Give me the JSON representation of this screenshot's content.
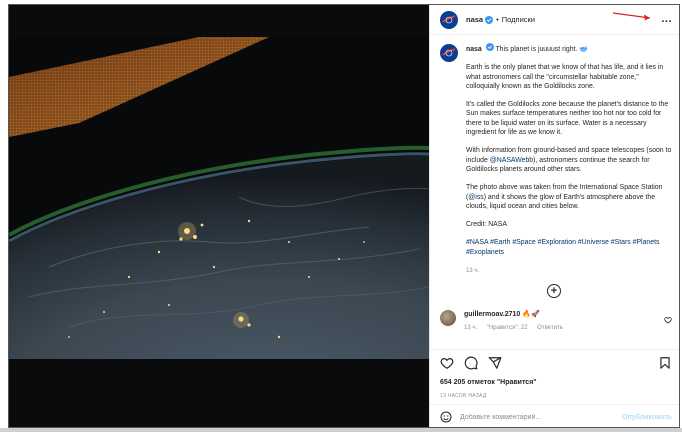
{
  "header": {
    "username": "nasa",
    "separator": "•",
    "follow_label": "Подписки",
    "more_label": "..."
  },
  "caption": {
    "username": "nasa",
    "intro": "This planet is juuuust right. 🥣",
    "para1": "Earth is the only planet that we know of that has life, and it lies in what astronomers call the \"circumstellar habitable zone,\" colloquially known as the Goldilocks zone.",
    "para2": "It's called the Goldilocks zone because the planet's distance to the Sun makes surface temperatures neither too hot nor too cold for there to be liquid water on its surface. Water is a necessary ingredient for life as we know it.",
    "para3_a": "With information from ground-based and space telescopes (soon to include ",
    "para3_link": "@NASAWebb",
    "para3_b": "), astronomers continue the search for Goldilocks planets around other stars.",
    "para4_a": "The photo above was taken from the International Space Station (",
    "para4_link": "@iss",
    "para4_b": ") and it shows the glow of Earth's atmosphere above the clouds, liquid ocean and cities below.",
    "credit": "Credit: NASA",
    "hashtags": "#NASA #Earth #Space #Exploration #Universe #Stars #Planets #Exoplanets",
    "time": "13 ч."
  },
  "load_more": "+",
  "comment": {
    "username": "guillermoav.2710",
    "text": "🔥🚀",
    "time": "13 ч.",
    "likes": "\"Нравится\": 22",
    "reply": "Ответить"
  },
  "likes_text": "654 205 отметок \"Нравится\"",
  "post_time": "13 ЧАСОВ НАЗАД",
  "comment_box": {
    "placeholder": "Добавьте комментарий...",
    "publish_label": "Опубликовать"
  },
  "colors": {
    "link": "#00376b",
    "publish_disabled": "#b2dffc",
    "annotation_arrow": "#e02020",
    "nasa_blue": "#0b3d91",
    "nasa_red": "#fc3d21"
  },
  "icons": [
    "nasa-logo-icon",
    "verified-badge-icon",
    "more-options-icon",
    "heart-icon",
    "comment-icon",
    "share-icon",
    "bookmark-icon",
    "emoji-icon",
    "plus-circle-icon"
  ]
}
